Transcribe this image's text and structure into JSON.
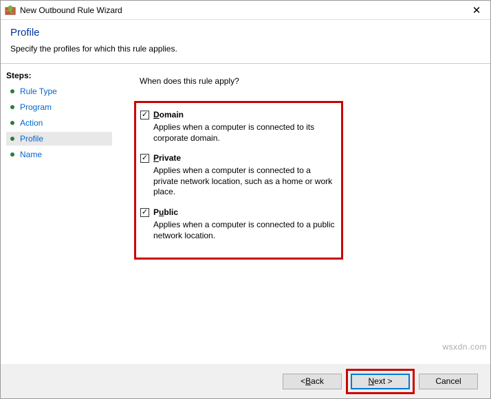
{
  "title": "New Outbound Rule Wizard",
  "header": {
    "title": "Profile",
    "desc": "Specify the profiles for which this rule applies."
  },
  "sidebar": {
    "heading": "Steps:",
    "items": [
      {
        "label": "Rule Type"
      },
      {
        "label": "Program"
      },
      {
        "label": "Action"
      },
      {
        "label": "Profile"
      },
      {
        "label": "Name"
      }
    ]
  },
  "content": {
    "question": "When does this rule apply?",
    "checks": [
      {
        "ul": "D",
        "rest": "omain",
        "desc": "Applies when a computer is connected to its corporate domain."
      },
      {
        "ul": "P",
        "rest": "rivate",
        "desc": "Applies when a computer is connected to a private network location, such as a home or work place."
      },
      {
        "ul": "P",
        "rest1": "P",
        "label_full": "Public",
        "ul_char": "u",
        "pre": "P",
        "post": "blic",
        "desc": "Applies when a computer is connected to a public network location."
      }
    ]
  },
  "footer": {
    "back_ul": "B",
    "back_rest": "ack",
    "next_ul": "N",
    "next_rest": "ext >",
    "cancel": "Cancel"
  },
  "watermark": "wsxdn.com"
}
